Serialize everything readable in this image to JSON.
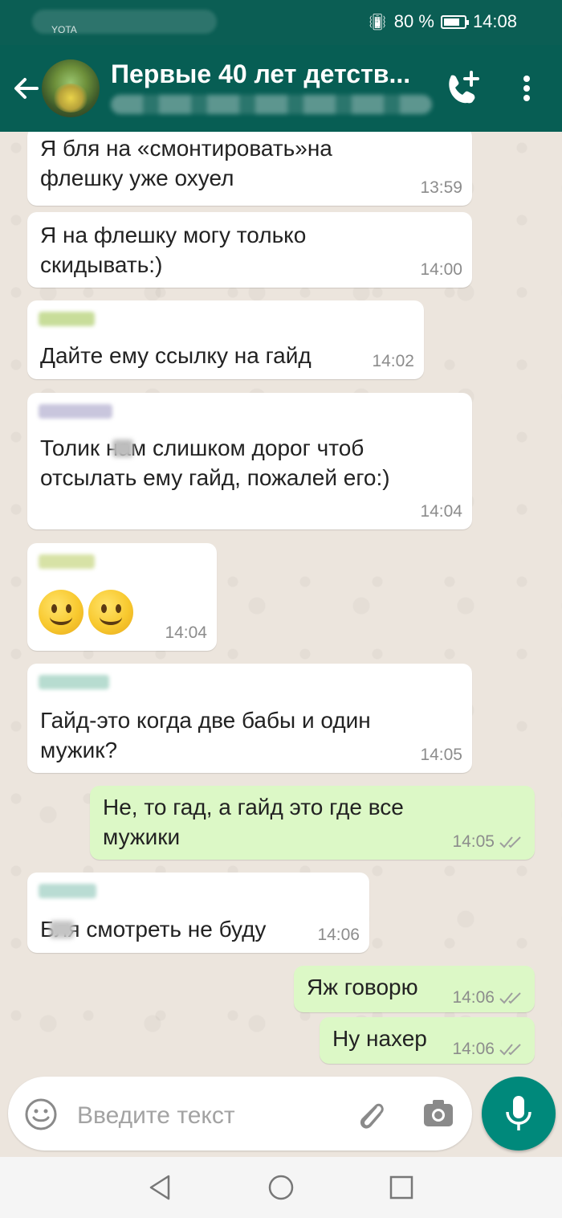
{
  "statusbar": {
    "carrier": "YOTA",
    "battery_percent": "80 %",
    "battery_level": 0.8,
    "time": "14:08"
  },
  "header": {
    "title": "Первые 40 лет детств...",
    "back_icon": "arrow-left-icon",
    "call_icon": "add-call-icon",
    "menu_icon": "more-vert-icon",
    "color": "#075e54"
  },
  "messages": [
    {
      "dir": "in",
      "text": "Я бля на «смонтировать»на\nфлешку уже охуел",
      "time": "13:59"
    },
    {
      "dir": "in",
      "text": "Я на флешку могу только\nскидывать:)",
      "time": "14:00"
    },
    {
      "dir": "in",
      "text": "Дайте ему ссылку на гайд",
      "time": "14:02"
    },
    {
      "dir": "in",
      "text": "Толик нам слишком дорог чтоб\nотсылать ему гайд, пожалей его:)",
      "time": "14:04"
    },
    {
      "dir": "in",
      "text": "",
      "emoji": [
        "slightly-smiling-face",
        "slightly-smiling-face"
      ],
      "time": "14:04"
    },
    {
      "dir": "in",
      "text": "Гайд-это когда две бабы и один\nмужик?",
      "time": "14:05"
    },
    {
      "dir": "out",
      "text": "Не, то гад, а гайд это где все\nмужики",
      "time": "14:05",
      "status": "read"
    },
    {
      "dir": "in",
      "text": "Бля смотреть не буду",
      "time": "14:06"
    },
    {
      "dir": "out",
      "text": "Яж говорю",
      "time": "14:06",
      "status": "read"
    },
    {
      "dir": "out",
      "text": "Ну нахер",
      "time": "14:06",
      "status": "read"
    }
  ],
  "composer": {
    "placeholder": "Введите текст",
    "value": "",
    "emoji_icon": "smile-icon",
    "attach_icon": "paperclip-icon",
    "camera_icon": "camera-icon",
    "mic_icon": "mic-icon",
    "accent": "#00897b"
  },
  "colors": {
    "incoming_bubble": "#ffffff",
    "outgoing_bubble": "#dcf8c6",
    "read_ticks": "#9e9e9e",
    "chat_background": "#ece5dd"
  }
}
